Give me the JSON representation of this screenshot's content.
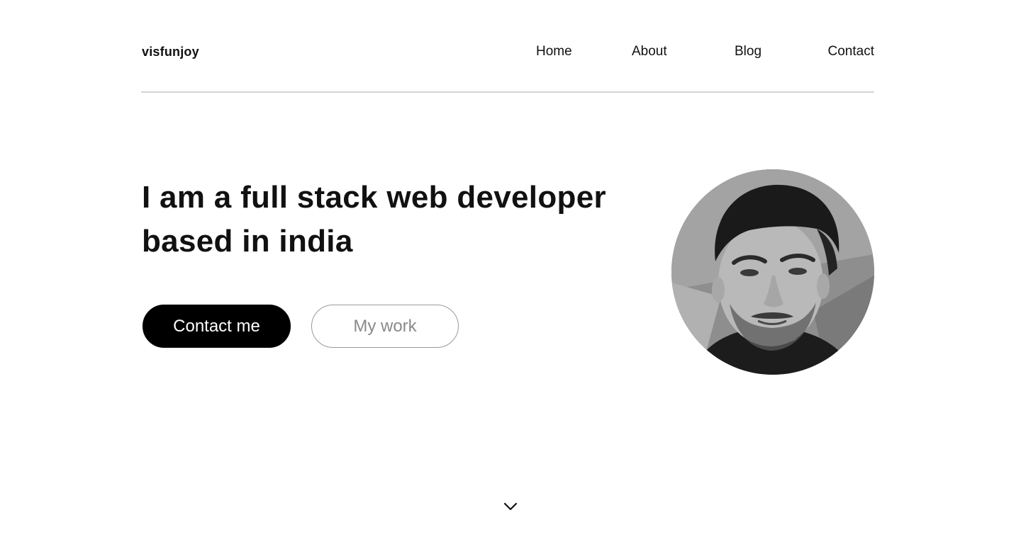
{
  "header": {
    "logo": "visfunjoy",
    "nav": [
      {
        "label": "Home"
      },
      {
        "label": "About"
      },
      {
        "label": "Blog"
      },
      {
        "label": "Contact"
      }
    ]
  },
  "hero": {
    "title": "I am a full stack web developer based in india",
    "primary_button": "Contact me",
    "secondary_button": "My work"
  },
  "icons": {
    "scroll": "chevron-down-icon",
    "avatar": "profile-photo"
  },
  "colors": {
    "text": "#111111",
    "primary_bg": "#000000",
    "primary_text": "#ffffff",
    "secondary_text": "#8a8a8a",
    "divider": "#d6d6d6"
  }
}
